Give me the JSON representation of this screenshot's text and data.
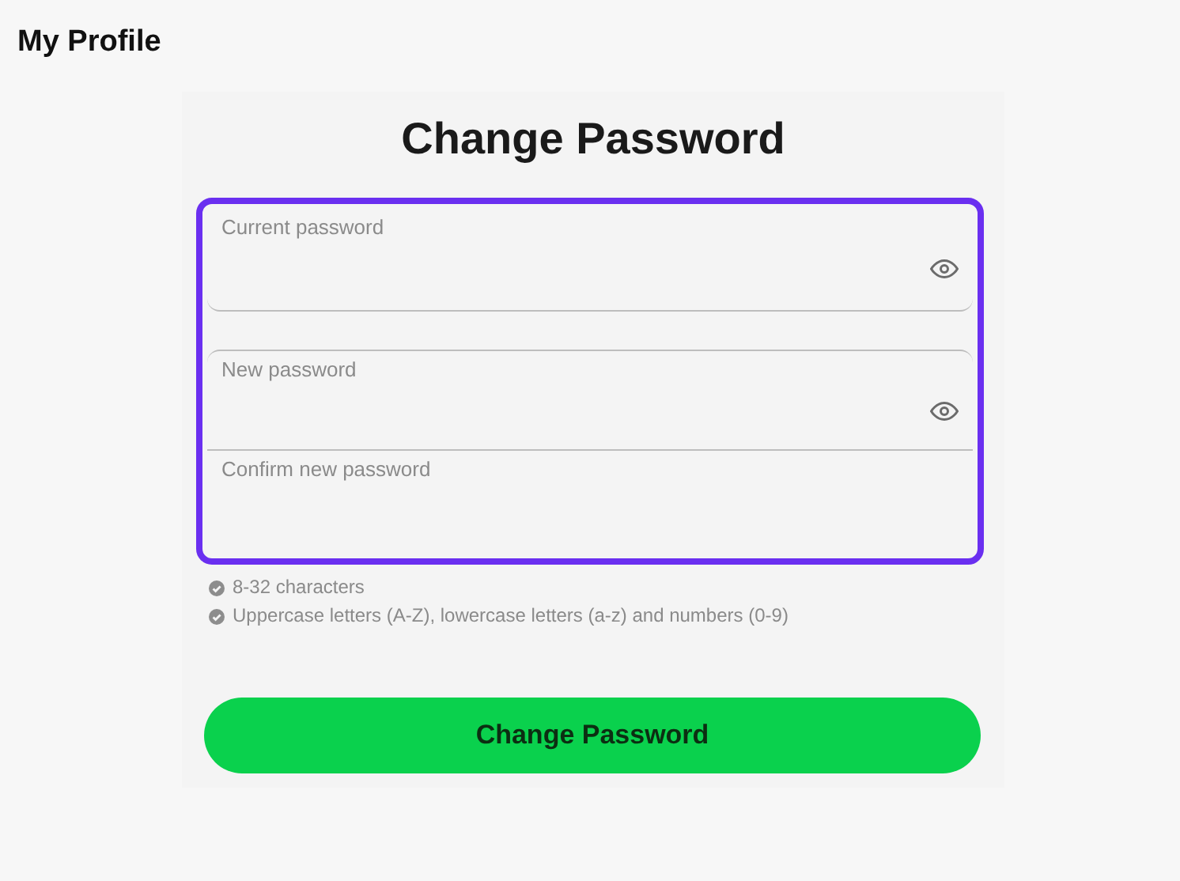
{
  "page_title": "My Profile",
  "form": {
    "title": "Change Password",
    "highlighted": true,
    "fields": [
      {
        "label": "Current password",
        "kind": "password_toggle"
      },
      {
        "label": "New password",
        "kind": "password_toggle"
      },
      {
        "label": "Confirm new password",
        "kind": "plain"
      }
    ],
    "requirements": [
      "8-32 characters",
      "Uppercase letters (A-Z), lowercase letters (a-z) and numbers (0-9)"
    ],
    "submit": "Change Password"
  }
}
